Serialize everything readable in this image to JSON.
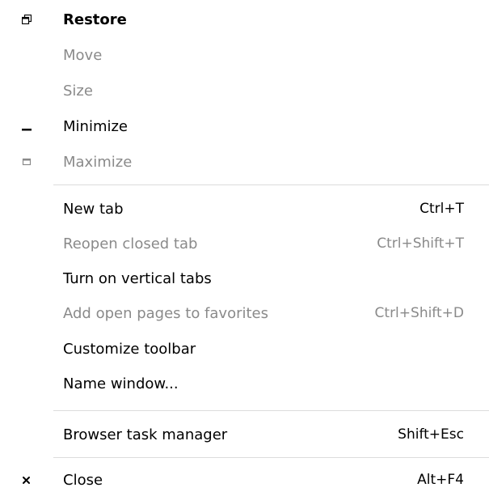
{
  "menu": {
    "restore": {
      "label": "Restore",
      "icon": "restore-icon"
    },
    "move": {
      "label": "Move"
    },
    "size": {
      "label": "Size"
    },
    "minimize": {
      "label": "Minimize",
      "icon": "minimize-icon"
    },
    "maximize": {
      "label": "Maximize",
      "icon": "maximize-icon"
    },
    "new_tab": {
      "label": "New tab",
      "shortcut": "Ctrl+T"
    },
    "reopen_closed_tab": {
      "label": "Reopen closed tab",
      "shortcut": "Ctrl+Shift+T"
    },
    "vertical_tabs": {
      "label": "Turn on vertical tabs"
    },
    "add_to_favorites": {
      "label": "Add open pages to favorites",
      "shortcut": "Ctrl+Shift+D"
    },
    "customize_toolbar": {
      "label": "Customize toolbar"
    },
    "name_window": {
      "label": "Name window..."
    },
    "task_manager": {
      "label": "Browser task manager",
      "shortcut": "Shift+Esc"
    },
    "close": {
      "label": "Close",
      "shortcut": "Alt+F4",
      "icon": "close-icon"
    }
  },
  "colors": {
    "enabled_text": "#000000",
    "disabled_text": "#8a8a8a",
    "separator": "#dcdcdc"
  }
}
